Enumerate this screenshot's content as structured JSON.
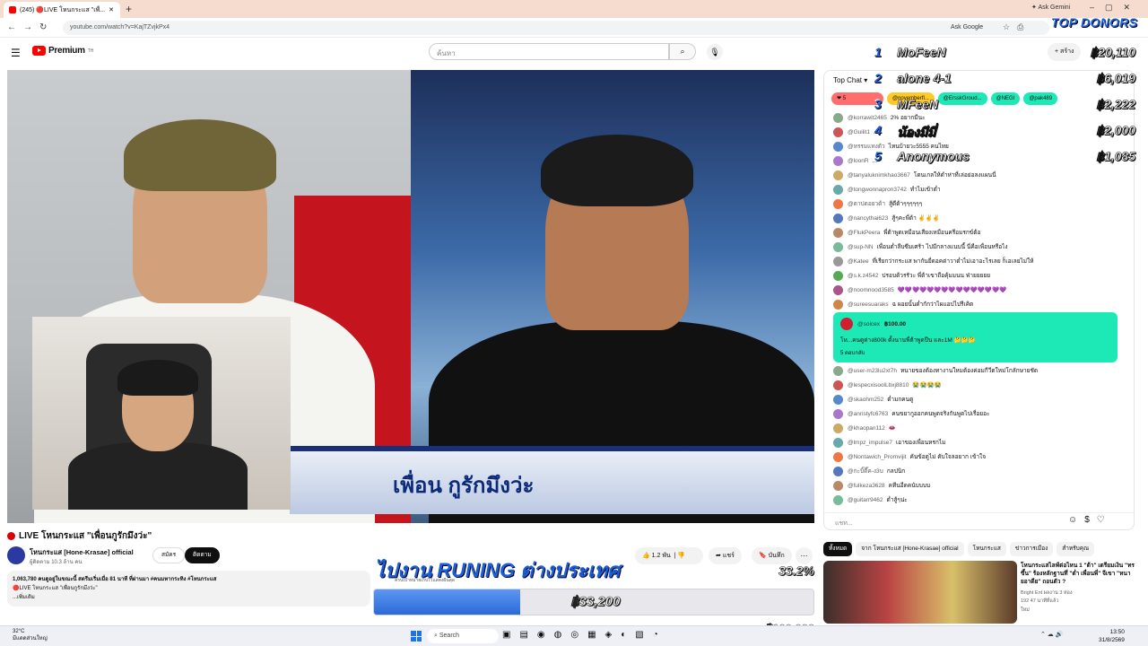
{
  "browser": {
    "tab_title": "(245) 🔴LIVE โหนกระแส \"เพื่...",
    "new_tab": "+",
    "ask_gemini": "Ask Gemini",
    "url": "youtube.com/watch?v=KajTZvjkPx4",
    "ask_google": "Ask Google"
  },
  "header": {
    "logo_text": "Premium",
    "logo_sup": "TH",
    "search_placeholder": "ค้นหา",
    "create_label": "สร้าง"
  },
  "video": {
    "caption": "เพื่อน กูรักมึงว่ะ",
    "title": "LIVE โหนกระแส \"เพื่อนกูรักมึงว่ะ\"",
    "channel_name": "โหนกระแส [Hone-Krasae] official",
    "subscribers": "ผู้ติดตาม 10.3 ล้าน คน",
    "join_label": "สมัคร",
    "subscribe_label": "ติดตาม",
    "likes": "1.2 พัน",
    "share_label": "แชร์",
    "save_label": "บันทึก",
    "description_stats": "1,063,780 คนดูอยู่ในขณะนี้  สตรีมเริ่มเมื่อ 81 นาที ที่ผ่านมา  #คนมหากระทิง #โหนกระแส",
    "description_line2": "🔴LIVE โหนกระแส \"เพื่อนกูรักมึงว่ะ\"",
    "description_more": "...เพิ่มเติม"
  },
  "overlay": {
    "run_title": "ไปงาน RUNING ต่างประเทศ",
    "run_percent": "33.2%",
    "run_current": "฿33,200",
    "run_target": "จาก ฿100,000",
    "run_progress": 0.332,
    "run_small_text": "ครบเป้าหมายเก็บไว้แสดงฝันสุด",
    "donor_title": "TOP DONORS",
    "donors": [
      {
        "rank": "1",
        "name": "MoFeeN",
        "amount": "฿20,110"
      },
      {
        "rank": "2",
        "name": "alone 4-1",
        "amount": "฿6,019"
      },
      {
        "rank": "3",
        "name": "MFeeN",
        "amount": "฿2,222"
      },
      {
        "rank": "4",
        "name": "น้องมีมี่",
        "amount": "฿2,000"
      },
      {
        "rank": "5",
        "name": "Anonymous",
        "amount": "฿1,085"
      }
    ]
  },
  "chat": {
    "header": "Top Chat ▾",
    "pinned": [
      "@novemberfl...",
      "@ErsskGroud...",
      "@NEGI",
      "@pak489"
    ],
    "messages": [
      {
        "author": "@korrawit2465",
        "text": "2% อยากมีนะ"
      },
      {
        "author": "@Guilit1",
        "text": "..."
      },
      {
        "author": "@หรรมแทงตัว",
        "text": "ไหนบ้ายวะ5555 คนไทย"
      },
      {
        "author": "@loonR",
        "text": "..."
      },
      {
        "author": "@tanyaluknimkhao3667",
        "text": "โดนเกลให้ดำห่าที่เล่อย่อลงแผนนี่"
      },
      {
        "author": "@tongwonnapron3742",
        "text": "ทำไมเข้าต่ำ"
      },
      {
        "author": "@ตาบ่ดอยวด้า",
        "text": "สู้ดีด้าๆๆๆๆๆๆ"
      },
      {
        "author": "@nancythai623",
        "text": "สู้ๆคะพี่ต้า ✌️✌️✌️"
      },
      {
        "author": "@FlukPeera",
        "text": "พี่ต้าพูดเหมือนเสียงเหมือนครีอมรกข์ต้อ"
      },
      {
        "author": "@sup-NN",
        "text": "เพื่อนต่ำลืบซีมเศร้า ไปมีกลางแนบนี้ นี่คือเพื่อนหรือไง"
      },
      {
        "author": "@Katee",
        "text": "ที่เรียกว่ากระแส พากันยี่ดอคต่าวาต่ำไม่เอาอะไรเลย ก็เอเลยไม่ให้"
      },
      {
        "author": "@s.k.z4542",
        "text": "ปรอบด้วรรัวะ พี่ต้าเขาถือคุ้มมนน ฟ่ายยยยย"
      },
      {
        "author": "@noomnood3585",
        "text": "💜💜💜💜💜💜💜💜💜💜💜💜💜💜💜"
      },
      {
        "author": "@sureesuaraks",
        "text": "ฉ ผอยนั้นต่ำกักว่าไผแอปไปรีเคิต"
      }
    ],
    "superchat": {
      "author": "@soicex",
      "amount": "฿100.00",
      "text": "โห...คนดูต่าง800k ตั้งนานพี่ต้าพูดปืน และ1M 🤔🤔🤔",
      "reactions": "5   ตอบกลับ"
    },
    "messages2": [
      {
        "author": "@user-m23lu2xt7h",
        "text": "หนายของต้องทางานใหมต้องค่อมกีวีตใหม่โกลักษายชัด"
      },
      {
        "author": "@lespecxisoolLbxj8810",
        "text": "😭😭😭😭"
      },
      {
        "author": "@skaohm252",
        "text": "ต่ำมกคนดู"
      },
      {
        "author": "@annstyfc6763",
        "text": "คนขยากูออกคนพูดจริงกันพูดไปเรื่อยอะ"
      },
      {
        "author": "@khaopan112",
        "text": "👄"
      },
      {
        "author": "@lmpz_impulse7",
        "text": "เอาของเพื่อนหรกไม"
      },
      {
        "author": "@Nontawich_Promvijit",
        "text": "คันข้อดูไม่ คับใจลอยาก เข้าใจ"
      },
      {
        "author": "@กะบิ๊ตี๊ค-ง3บ",
        "text": "กลปนิก"
      },
      {
        "author": "@fulkeza3628",
        "text": "คทีนอืดคนับบบบ"
      },
      {
        "author": "@guitarr9462",
        "text": "ต่ำสู้ๆน่ะ"
      }
    ],
    "input_placeholder": "แชท..."
  },
  "related": {
    "chips": [
      "ทั้งหมด",
      "จาก โหนกระแส [Hone-Krasae] official",
      "โหนกระแส",
      "ข่าวการเมือง",
      "สำหรับคุณ"
    ],
    "title": "โหนกระแสไลฟ์ต่อไหน 1 \"ต้า\" เตรียมเงิน \"ทรขึ้น\" ร้องหลักฐานทึ่ \"ต่ำ เพื่อนพี่\" จีเขา \"หนายอาดีย\" ถอนตัว ?",
    "channel": "Bright Ent ผลงาน 3 ห่อง",
    "meta": "192   47 นาทีที่แล้ว",
    "badge": "ใหม่"
  },
  "taskbar": {
    "weather_temp": "32°C",
    "weather_desc": "มีแดดส่วนใหญ่",
    "search_label": "Search",
    "time": "13:50",
    "date": "31/8/2569"
  }
}
